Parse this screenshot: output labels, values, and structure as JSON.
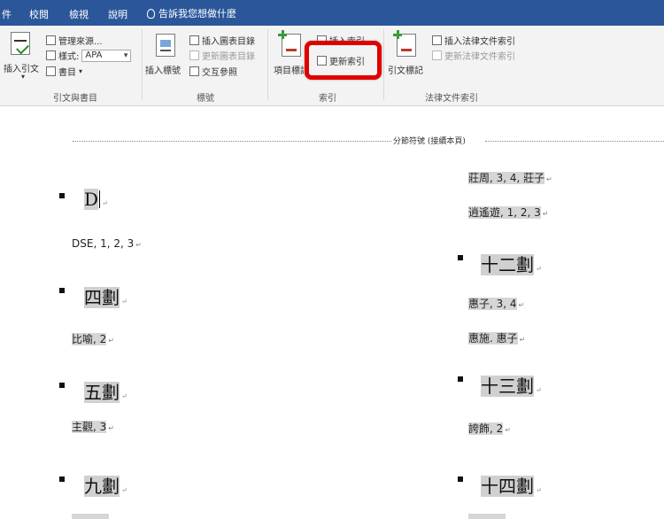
{
  "menubar": {
    "tabs": [
      "件",
      "校閱",
      "檢視",
      "說明"
    ],
    "tell_me": "告訴我您想做什麼"
  },
  "ribbon": {
    "citations": {
      "insert_citation": "插入引文",
      "manage_sources": "管理來源...",
      "style_label": "樣式:",
      "style_value": "APA",
      "bibliography": "書目",
      "group_label": "引文與書目"
    },
    "captions": {
      "insert_caption": "插入標號",
      "insert_table_of_figures": "插入圖表目錄",
      "update_table": "更新圖表目錄",
      "cross_reference": "交互參照",
      "group_label": "標號"
    },
    "index": {
      "mark_entry": "項目標記",
      "insert_index": "插入索引",
      "update_index": "更新索引",
      "group_label": "索引"
    },
    "table_of_authorities": {
      "mark_citation": "引文標記",
      "insert_toa": "插入法律文件索引",
      "update_toa": "更新法律文件索引",
      "group_label": "法律文件索引"
    }
  },
  "document": {
    "section_break": "分節符號 (接續本頁)",
    "left_column": {
      "groups": [
        {
          "heading": "D",
          "entries": [
            "DSE, 1, 2, 3"
          ]
        },
        {
          "heading": "四劃",
          "entries": [
            "比喻, 2"
          ]
        },
        {
          "heading": "五劃",
          "entries": [
            "主觀, 3"
          ]
        },
        {
          "heading": "九劃",
          "entries": []
        }
      ]
    },
    "right_column": {
      "lead_entries": [
        "莊周, 3, 4, 莊子",
        "逍遙遊, 1, 2, 3"
      ],
      "groups": [
        {
          "heading": "十二劃",
          "entries": [
            "惠子, 3, 4",
            "惠施. 惠子"
          ]
        },
        {
          "heading": "十三劃",
          "entries": [
            "誇飾, 2"
          ]
        },
        {
          "heading": "十四劃",
          "entries": []
        }
      ]
    }
  },
  "colors": {
    "menubar": "#2b579a",
    "highlight_box": "#e10000",
    "index_shading": "#d0d0d0"
  }
}
